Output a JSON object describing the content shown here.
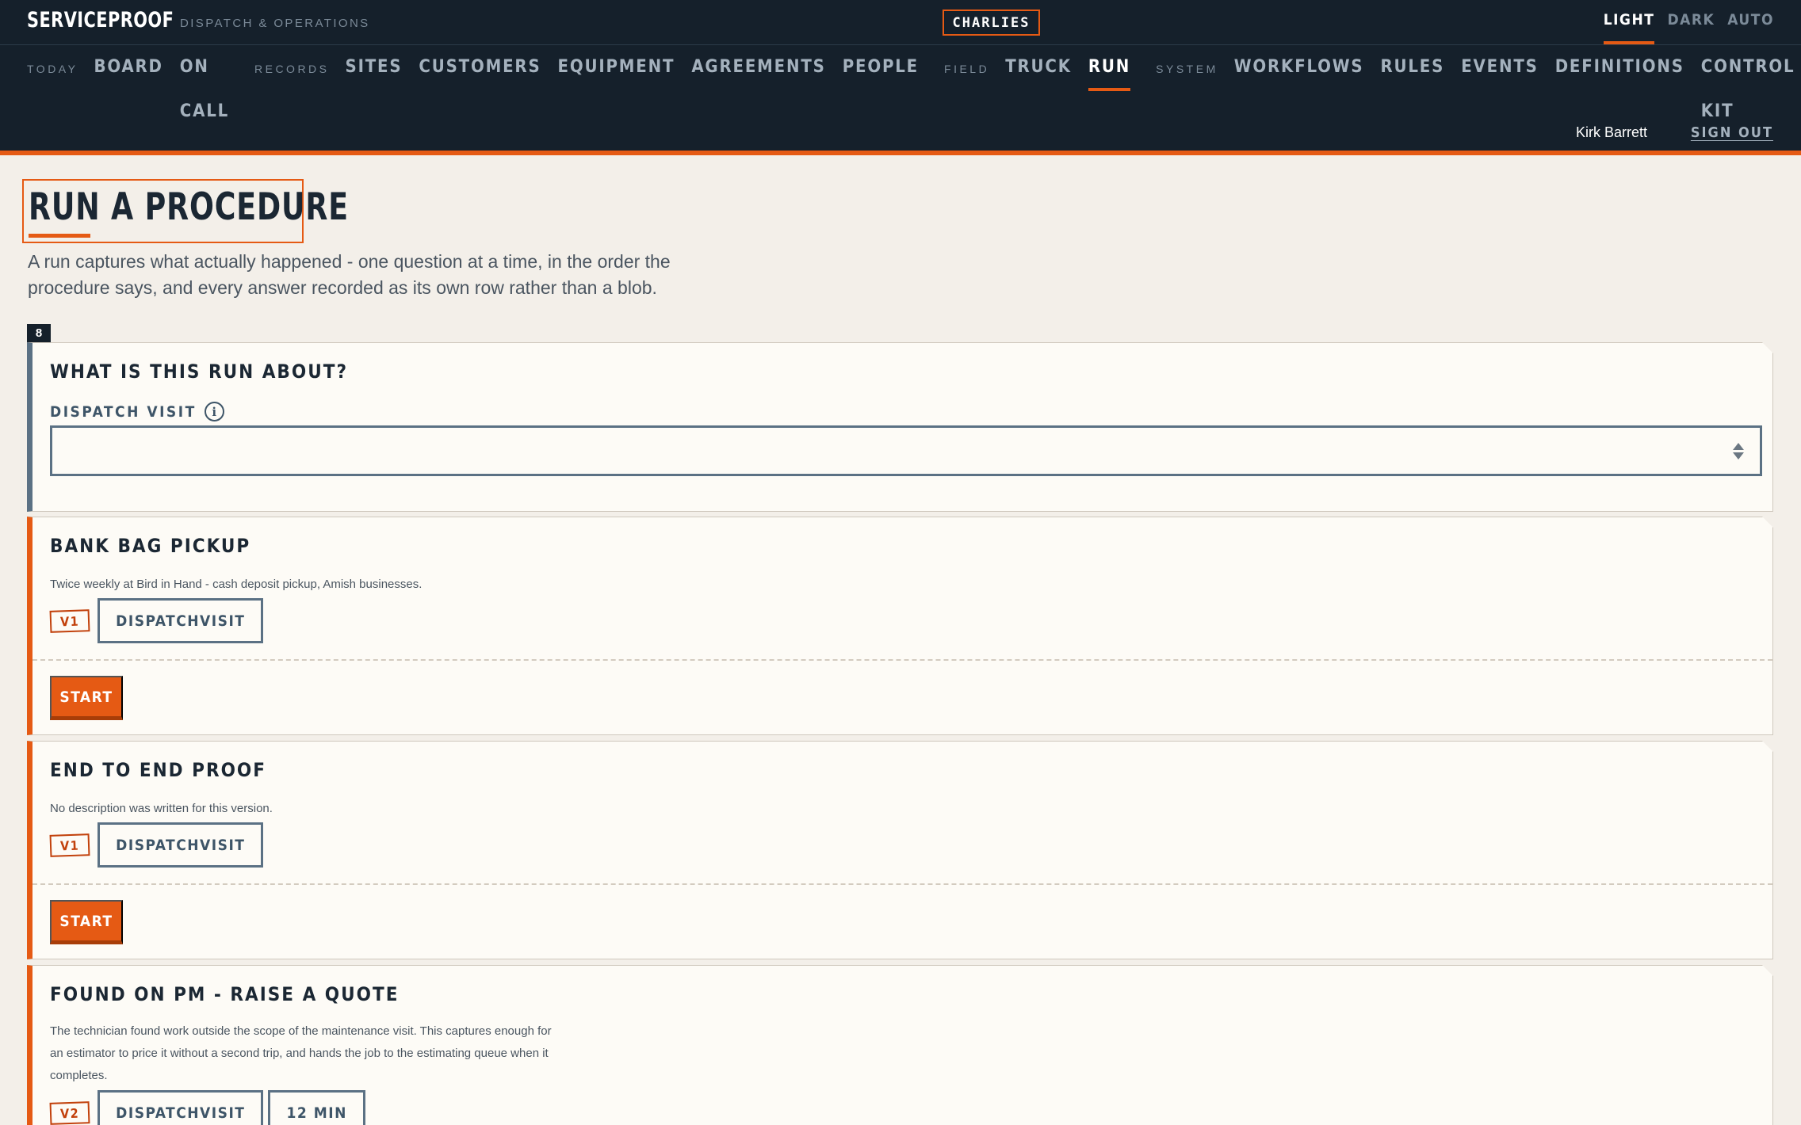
{
  "app": {
    "brand": "SERVICEPROOF",
    "tagline": "DISPATCH & OPERATIONS",
    "tenant": "CHARLIES",
    "theme_options": [
      "LIGHT",
      "DARK",
      "AUTO"
    ],
    "active_theme": "LIGHT"
  },
  "nav": {
    "groups": {
      "today": "TODAY",
      "records": "RECORDS",
      "field": "FIELD",
      "system": "SYSTEM"
    },
    "items": {
      "board": "BOARD",
      "on_call": "ON CALL",
      "sites": "SITES",
      "customers": "CUSTOMERS",
      "equipment": "EQUIPMENT",
      "agreements": "AGREEMENTS",
      "people": "PEOPLE",
      "truck": "TRUCK",
      "run": "RUN",
      "workflows": "WORKFLOWS",
      "rules": "RULES",
      "events": "EVENTS",
      "definitions": "DEFINITIONS",
      "control_kit": "CONTROL KIT"
    },
    "active": "RUN"
  },
  "user": {
    "name": "Kirk Barrett",
    "sign_out": "SIGN OUT"
  },
  "page": {
    "title": "RUN A PROCEDURE",
    "description": "A run captures what actually happened - one question at a time, in the order the procedure says, and every answer recorded as its own row rather than a blob.",
    "procedure_count": "8"
  },
  "about_card": {
    "title": "WHAT IS THIS RUN ABOUT?",
    "field_label": "DISPATCH VISIT",
    "info_icon": "info-icon",
    "selected_value": ""
  },
  "procedures": [
    {
      "title": "BANK BAG PICKUP",
      "description": "Twice weekly at Bird in Hand - cash deposit pickup, Amish businesses.",
      "version": "V1",
      "tags": [
        "DISPATCHVISIT"
      ],
      "action": "START"
    },
    {
      "title": "END TO END PROOF",
      "description": "No description was written for this version.",
      "version": "V1",
      "tags": [
        "DISPATCHVISIT"
      ],
      "action": "START"
    },
    {
      "title": "FOUND ON PM - RAISE A QUOTE",
      "description": "The technician found work outside the scope of the maintenance visit. This captures enough for an estimator to price it without a second trip, and hands the job to the estimating queue when it completes.",
      "version": "V2",
      "tags": [
        "DISPATCHVISIT",
        "12 MIN"
      ]
    }
  ],
  "colors": {
    "accent": "#e55a14",
    "nav_bg": "#15202b",
    "page_bg": "#f3efe9",
    "card_bg": "#fdfbf6",
    "slate": "#5b7184"
  }
}
